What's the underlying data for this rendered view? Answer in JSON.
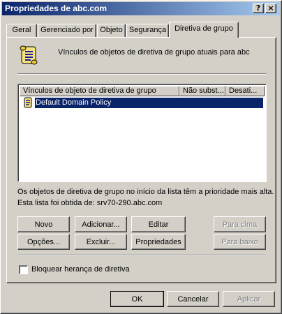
{
  "window": {
    "title": "Propriedades de abc.com",
    "help_glyph": "?",
    "close_glyph": "×"
  },
  "tabs": [
    {
      "label": "Geral"
    },
    {
      "label": "Gerenciado por"
    },
    {
      "label": "Objeto"
    },
    {
      "label": "Segurança"
    },
    {
      "label": "Diretiva de grupo",
      "active": true
    }
  ],
  "header": {
    "icon": "group-policy-scroll-icon",
    "text": "Vínculos de objetos de diretiva de grupo atuais para abc"
  },
  "list": {
    "columns": [
      "Vínculos de objeto de diretiva de grupo",
      "Não subst...",
      "Desati..."
    ],
    "rows": [
      {
        "name": "Default Domain Policy",
        "icon": "policy-object-icon",
        "selected": true
      }
    ]
  },
  "info": {
    "line1": "Os objetos de diretiva de grupo no início da lista têm a prioridade mais alta.",
    "line2": "Esta lista foi obtida de: srv70-290.abc.com"
  },
  "buttons": {
    "novo": "Novo",
    "adicionar": "Adicionar...",
    "editar": "Editar",
    "para_cima": "Para cima",
    "opcoes": "Opções...",
    "excluir": "Excluir...",
    "propriedades": "Propriedades",
    "para_baixo": "Para baixo"
  },
  "checkbox": {
    "label": "Bloquear herança de diretiva",
    "checked": false
  },
  "footer": {
    "ok": "OK",
    "cancelar": "Cancelar",
    "aplicar": "Aplicar"
  },
  "colors": {
    "title_gradient_start": "#0a246a",
    "title_gradient_end": "#a6caf0",
    "face": "#d4d0c8",
    "selection": "#0a246a"
  }
}
